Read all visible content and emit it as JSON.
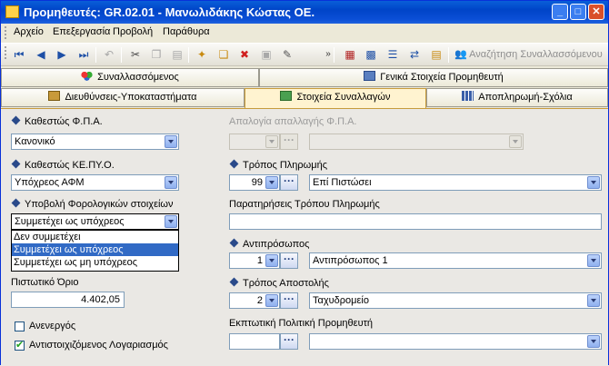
{
  "window": {
    "title": "Προμηθευτές: GR.02.01 - Μανωλιδάκης Κώστας ΟΕ.",
    "controls": [
      "minimize",
      "maximize",
      "close"
    ]
  },
  "menu": [
    "Αρχείο",
    "Επεξεργασία",
    "Προβολή",
    "Παράθυρα"
  ],
  "toolbar": {
    "icons": [
      "first-record-icon",
      "prev-record-icon",
      "next-record-icon",
      "last-record-icon",
      "undo-icon",
      "cut-icon",
      "copy-icon",
      "paste-icon",
      "new-icon",
      "new-copy-icon",
      "delete-icon",
      "save-icon",
      "edit-icon",
      "more-icon",
      "layout-icon",
      "print-icon",
      "list-icon",
      "transfer-icon",
      "report-icon"
    ],
    "search_label": "Αναζήτηση Συναλλασσόμενου"
  },
  "tabs_row1": [
    "Συναλλασσόμενος",
    "Γενικά Στοιχεία Προμηθευτή"
  ],
  "tabs_row2": [
    "Διευθύνσεις-Υποκαταστήματα",
    "Στοιχεία Συναλλαγών",
    "Αποπληρωμή-Σχόλια"
  ],
  "active_tab": "Στοιχεία Συναλλαγών",
  "form": {
    "vat_status_label": "Καθεστώς Φ.Π.Α.",
    "vat_status_value": "Κανονικό",
    "vat_exemption_label": "Απαλογία απαλλαγής Φ.Π.Α.",
    "kepyo_label": "Καθεστώς ΚΕ.ΠΥ.Ο.",
    "kepyo_value": "Υπόχρεος ΑΦΜ",
    "tax_submission_label": "Υποβολή Φορολογικών στοιχείων",
    "tax_submission_value": "Συμμετέχει ως υπόχρεος",
    "tax_submission_options": [
      "Δεν συμμετέχει",
      "Συμμετέχει ως υπόχρεος",
      "Συμμετέχει ως μη υπόχρεος"
    ],
    "tax_submission_selected_index": 1,
    "payment_method_label": "Τρόπος Πληρωμής",
    "payment_method_code": "99",
    "payment_method_value": "Επί Πιστώσει",
    "payment_notes_label": "Παρατηρήσεις Τρόπου Πληρωμής",
    "payment_notes_value": "",
    "credit_limit_label": "Πιστωτικό Όριο",
    "credit_limit_value": "4.402,05",
    "representative_label": "Αντιπρόσωπος",
    "representative_code": "1",
    "representative_value": "Αντιπρόσωπος 1",
    "shipping_label": "Τρόπος Αποστολής",
    "shipping_code": "2",
    "shipping_value": "Ταχυδρομείο",
    "discount_policy_label": "Εκπτωτική Πολιτική Προμηθευτή",
    "inactive_label": "Ανενεργός",
    "inactive_checked": false,
    "linked_account_label": "Αντιστοιχιζόμενος Λογαριασμός",
    "linked_account_checked": true
  }
}
